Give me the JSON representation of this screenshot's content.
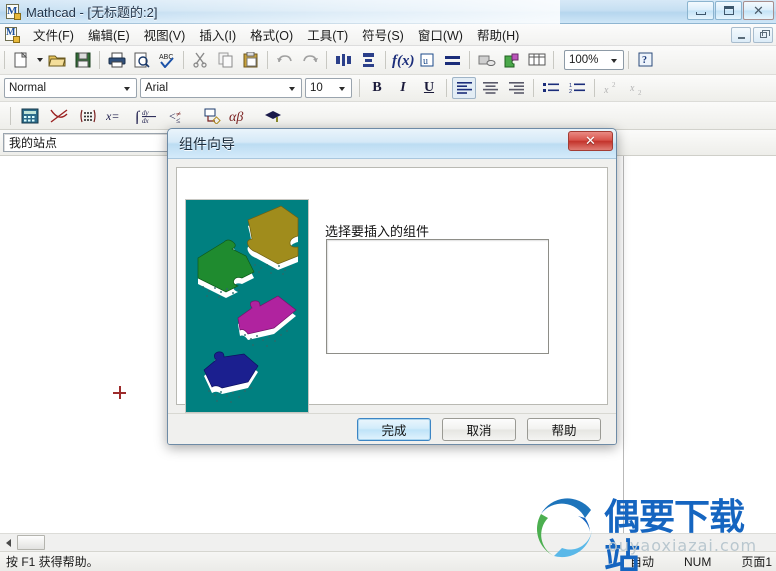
{
  "window": {
    "title": "Mathcad - [无标题的:2]",
    "app_icon": "mathcad-icon",
    "controls": {
      "minimize": "–",
      "maximize": "□",
      "close": "✕"
    },
    "mdi_controls": {
      "minimize": "–",
      "restore": "❐"
    }
  },
  "menubar": {
    "items": [
      {
        "label": "文件(F)",
        "name": "menu-file"
      },
      {
        "label": "编辑(E)",
        "name": "menu-edit"
      },
      {
        "label": "视图(V)",
        "name": "menu-view"
      },
      {
        "label": "插入(I)",
        "name": "menu-insert"
      },
      {
        "label": "格式(O)",
        "name": "menu-format"
      },
      {
        "label": "工具(T)",
        "name": "menu-tools"
      },
      {
        "label": "符号(S)",
        "name": "menu-symbolics"
      },
      {
        "label": "窗口(W)",
        "name": "menu-window"
      },
      {
        "label": "帮助(H)",
        "name": "menu-help"
      }
    ]
  },
  "toolbar_standard": {
    "zoom_value": "100%",
    "buttons": [
      "new-document-icon",
      "new-dropdown-icon",
      "open-folder-icon",
      "save-icon",
      "print-icon",
      "print-preview-icon",
      "spellcheck-icon",
      "cut-scissors-icon",
      "copy-icon",
      "paste-clipboard-icon",
      "undo-icon",
      "redo-icon",
      "align-across-icon",
      "align-down-icon",
      "insert-function-icon",
      "insert-unit-icon",
      "calculate-equals-icon",
      "insert-hyperlink-icon",
      "insert-component-icon",
      "insert-matrix-icon",
      "help-question-icon"
    ]
  },
  "toolbar_format": {
    "style_value": "Normal",
    "font_value": "Arial",
    "size_value": "10",
    "bold_label": "B",
    "italic_label": "I",
    "underline_label": "U",
    "buttons": [
      "align-left-icon",
      "align-center-icon",
      "align-right-icon",
      "bulleted-list-icon",
      "numbered-list-icon",
      "superscript-icon",
      "subscript-icon"
    ]
  },
  "toolbar_math": {
    "buttons": [
      "calculator-icon",
      "graph-icon",
      "matrix-icon",
      "evaluation-icon",
      "calculus-icon",
      "boolean-icon",
      "programming-icon",
      "greek-alphabet-icon",
      "symbolic-keyword-icon"
    ]
  },
  "sitebar": {
    "value": "我的站点",
    "name": "my-site-field"
  },
  "document": {
    "cursor": "red-crosshair-cursor"
  },
  "dialog": {
    "title": "组件向导",
    "close_label": "✕",
    "prompt": "选择要插入的组件",
    "listbox_items": [],
    "image": {
      "name": "puzzle-pieces-illustration",
      "background_color": "#008080",
      "pieces": [
        {
          "color": "#a08c1c",
          "label": "olive-puzzle-piece"
        },
        {
          "color": "#1f8b2f",
          "label": "green-puzzle-piece"
        },
        {
          "color": "#b0239f",
          "label": "magenta-puzzle-piece"
        },
        {
          "color": "#1b1f8f",
          "label": "blue-puzzle-piece"
        }
      ]
    },
    "buttons": {
      "finish": "完成",
      "cancel": "取消",
      "help": "帮助"
    }
  },
  "statusbar": {
    "message": "按 F1 获得帮助。",
    "auto": "自动",
    "num": "NUM",
    "page": "页面1"
  },
  "watermark": {
    "title": "偶要下载站",
    "url": "ouyaoxiazai.com",
    "color": "#1565c0"
  },
  "colors": {
    "accent": "#1565c0",
    "dialog_border": "#6e8ba6",
    "teal": "#008080"
  }
}
